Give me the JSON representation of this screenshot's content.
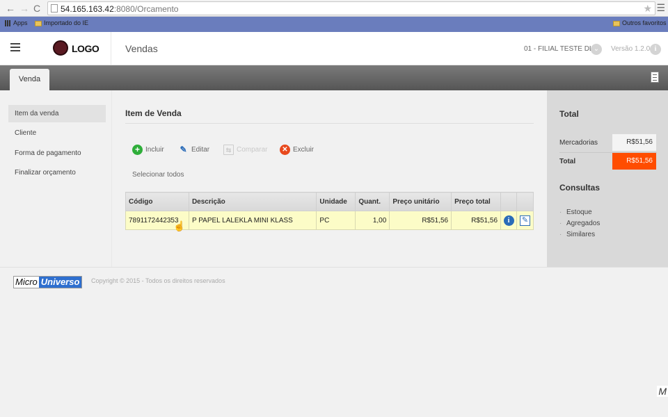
{
  "browser": {
    "url_host": "54.165.163.42",
    "url_rest": ":8080/Orcamento",
    "bookmarks": [
      "Apps",
      "Importado do IE"
    ],
    "other_bookmarks": "Outros favoritos"
  },
  "header": {
    "logo_text": "LOGO",
    "title": "Vendas",
    "branch": "01 - FILIAL TESTE DLL",
    "version": "Versão 1.2.0"
  },
  "tabs": [
    {
      "label": "Venda"
    }
  ],
  "sidebar": {
    "items": [
      {
        "label": "Item da venda"
      },
      {
        "label": "Cliente"
      },
      {
        "label": "Forma de pagamento"
      },
      {
        "label": "Finalizar orçamento"
      }
    ]
  },
  "main": {
    "section_title": "Item de Venda",
    "toolbar": {
      "incluir": "Incluir",
      "editar": "Editar",
      "comparar": "Comparar",
      "excluir": "Excluir"
    },
    "select_all": "Selecionar todos",
    "table": {
      "headers": [
        "Código",
        "Descrição",
        "Unidade",
        "Quant.",
        "Preço unitário",
        "Preço total"
      ],
      "rows": [
        {
          "codigo": "7891172442353",
          "descricao": "P PAPEL LALEKLA MINI KLASS",
          "unidade": "PC",
          "quant": "1,00",
          "preco_unitario": "R$51,56",
          "preco_total": "R$51,56"
        }
      ]
    }
  },
  "right_panel": {
    "total_title": "Total",
    "mercadorias_label": "Mercadorias",
    "mercadorias_value": "R$51,56",
    "total_label": "Total",
    "total_value": "R$51,56",
    "consultas_title": "Consultas",
    "links": [
      "Estoque",
      "Agregados",
      "Similares"
    ]
  },
  "footer": {
    "brand_part1": "Micro",
    "brand_part2": "Universo",
    "copyright": "Copyright © 2015 - Todos os direitos reservados",
    "corner_letter": "M"
  },
  "colors": {
    "accent_total": "#ff4d00",
    "row_highlight": "#fcfcc7",
    "brand_blue": "#2e6fcf"
  },
  "icons": [
    "back-icon",
    "forward-icon",
    "reload-icon",
    "star-icon",
    "menu-icon",
    "hamburger-icon",
    "chevron-down-icon",
    "info-icon",
    "document-icon",
    "add-icon",
    "edit-icon",
    "compare-icon",
    "delete-icon",
    "pointer-cursor-icon"
  ]
}
